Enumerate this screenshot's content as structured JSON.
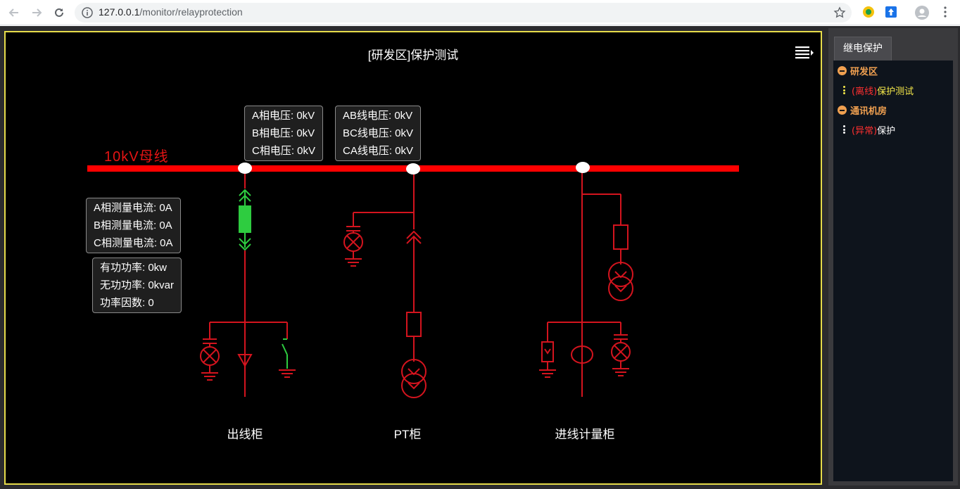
{
  "browser": {
    "url_host": "127.0.0.1",
    "url_path": "/monitor/relayprotection"
  },
  "scada": {
    "title": "[研发区]保护测试",
    "bus_label": "10kV母线",
    "outgoing_current_box": {
      "lines": [
        "A相测量电流: 0A",
        "B相测量电流: 0A",
        "C相测量电流: 0A"
      ]
    },
    "outgoing_power_box": {
      "lines": [
        "有功功率: 0kw",
        "无功功率: 0kvar",
        "功率因数: 0"
      ]
    },
    "phase_voltage_box": {
      "lines": [
        "A相电压: 0kV",
        "B相电压: 0kV",
        "C相电压: 0kV"
      ]
    },
    "line_voltage_box": {
      "lines": [
        "AB线电压: 0kV",
        "BC线电压: 0kV",
        "CA线电压: 0kV"
      ]
    },
    "cabinets": [
      "出线柜",
      "PT柜",
      "进线计量柜"
    ],
    "colors": {
      "busbar": "#ff0000",
      "equipment": "#d4141e",
      "switch_green": "#2ecc40",
      "border": "#e6dc4a"
    }
  },
  "sidebar": {
    "tab_label": "继电保护",
    "tree": [
      {
        "label": "研发区",
        "children": [
          {
            "status": "(离线)",
            "name": "保护测试",
            "status_color": "#ff3030",
            "name_color": "#f5e84a",
            "dot_color": "#f5e84a"
          }
        ]
      },
      {
        "label": "通讯机房",
        "children": [
          {
            "status": "(异常)",
            "name": "保护",
            "status_color": "#ff3030",
            "name_color": "#ffffff",
            "dot_color": "#ffffff"
          }
        ]
      }
    ]
  }
}
